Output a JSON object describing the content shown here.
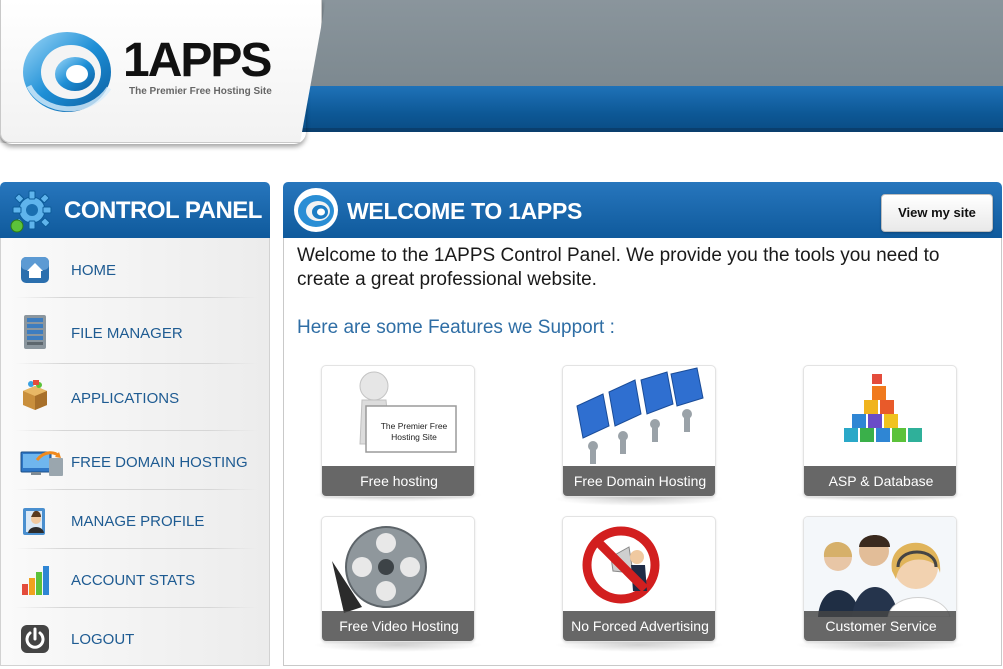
{
  "brand": {
    "name": "1APPS",
    "tagline": "The Premier Free Hosting Site",
    "colors": {
      "header_blue": "#0d5896",
      "header_gray": "#7d8990",
      "link_blue": "#1e5b92"
    }
  },
  "sidebar": {
    "title": "CONTROL PANEL",
    "icon": "gear-icon",
    "items": [
      {
        "label": "HOME",
        "icon": "home-icon"
      },
      {
        "label": "FILE MANAGER",
        "icon": "server-icon"
      },
      {
        "label": "APPLICATIONS",
        "icon": "box-icon"
      },
      {
        "label": "FREE DOMAIN HOSTING",
        "icon": "computer-icon"
      },
      {
        "label": "MANAGE PROFILE",
        "icon": "profile-icon"
      },
      {
        "label": "ACCOUNT STATS",
        "icon": "bar-chart-icon"
      },
      {
        "label": "LOGOUT",
        "icon": "power-icon"
      }
    ]
  },
  "main": {
    "title": "WELCOME TO 1APPS",
    "view_site_label": "View my site",
    "intro": "Welcome to the 1APPS Control Panel. We provide you the tools you need to create a great professional website.",
    "features_title": "Here are some Features we Support :",
    "features": [
      {
        "label": "Free hosting",
        "icon": "hosting-sign-icon",
        "sign_text": "The Premier Free Hosting Site"
      },
      {
        "label": "Free Domain Hosting",
        "icon": "www-icon"
      },
      {
        "label": "ASP & Database",
        "icon": "cubes-icon"
      },
      {
        "label": "Free Video Hosting",
        "icon": "film-reel-icon"
      },
      {
        "label": "No Forced Advertising",
        "icon": "no-ads-icon"
      },
      {
        "label": "Customer Service",
        "icon": "support-agents-icon"
      }
    ]
  }
}
